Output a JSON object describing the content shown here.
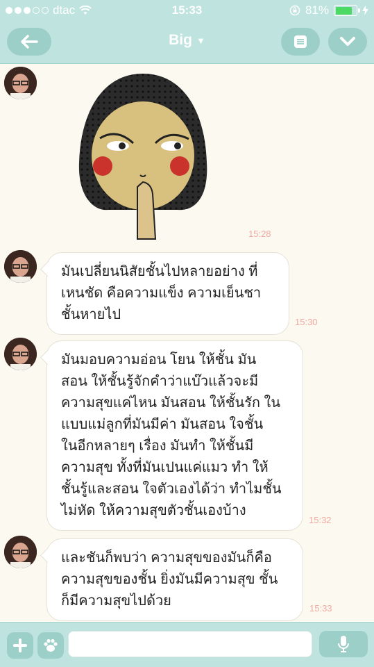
{
  "status_bar": {
    "carrier": "dtac",
    "time": "15:33",
    "battery_text": "81%",
    "battery_level": 0.81
  },
  "header": {
    "title": "Big",
    "back_icon": "arrow-left-icon",
    "menu_icon": "list-icon",
    "down_icon": "chevron-down-icon"
  },
  "messages": [
    {
      "type": "sticker",
      "time": "15:28"
    },
    {
      "type": "text",
      "lines": [
        "มันเปลี่ยนนิสัยชั้นไปหลายอย่าง ที่",
        "เหนชัด คือความแข็ง ความเย็นชา",
        "ชั้นหายไป"
      ],
      "time": "15:30"
    },
    {
      "type": "text",
      "lines": [
        "มันมอบความอ่อน โยน ให้ชั้น มัน",
        "สอน ให้ชั้นรู้จักคำว่าแบ๊วแล้วจะมี",
        "ความสุขแค่ไหน มันสอน ให้ชั้นรัก ใน",
        "แบบแม่ลูกที่มันมีค่า มันสอน ใจชั้น",
        "ในอีกหลายๆ เรื่อง มันทำ ให้ชั้นมี",
        "ความสุข ทั้งที่มันเปนแค่แมว ทำ ให้",
        "ชั้นรู้และสอน ใจตัวเองได้ว่า ทำไมชั้น",
        "ไม่หัด ให้ความสุขตัวชั้นเองบ้าง"
      ],
      "time": "15:32"
    },
    {
      "type": "text",
      "lines": [
        "และชันก็พบว่า ความสุขของมันก็คือ",
        "ความสุขของชั้น ยิ่งมันมีความสุข ชั้น",
        "ก็มีความสุขไปด้วย"
      ],
      "time": "15:33"
    }
  ],
  "input_bar": {
    "plus_icon": "plus-icon",
    "sticker_icon": "paw-icon",
    "mic_icon": "microphone-icon",
    "placeholder": ""
  },
  "colors": {
    "bar": "#bfe3de",
    "button": "#9ccfc8",
    "timestamp": "#f2a9a0",
    "background": "#fbf9f0"
  }
}
